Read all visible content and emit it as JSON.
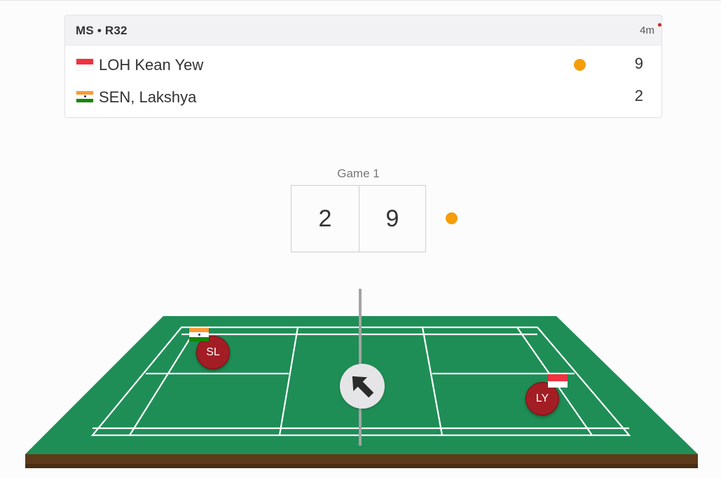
{
  "match": {
    "title": "MS • R32",
    "elapsed": "4m",
    "players": [
      {
        "name": "LOH Kean Yew",
        "country": "Singapore",
        "flag": "flag-singapore-icon",
        "score": "9",
        "serving": true
      },
      {
        "name": "SEN, Lakshya",
        "country": "India",
        "flag": "flag-india-icon",
        "score": "2",
        "serving": false
      }
    ]
  },
  "game": {
    "label": "Game 1",
    "left_score": "2",
    "right_score": "9",
    "serving_side": "right"
  },
  "court": {
    "left_player_initials": "SL",
    "right_player_initials": "LY",
    "shuttle_direction_icon": "arrow-up-left-icon",
    "colors": {
      "court_green": "#1e8e56",
      "court_base": "#5d3a1a",
      "line": "#ffffff",
      "token": "#a31d24",
      "serve": "#f59e0b"
    }
  }
}
